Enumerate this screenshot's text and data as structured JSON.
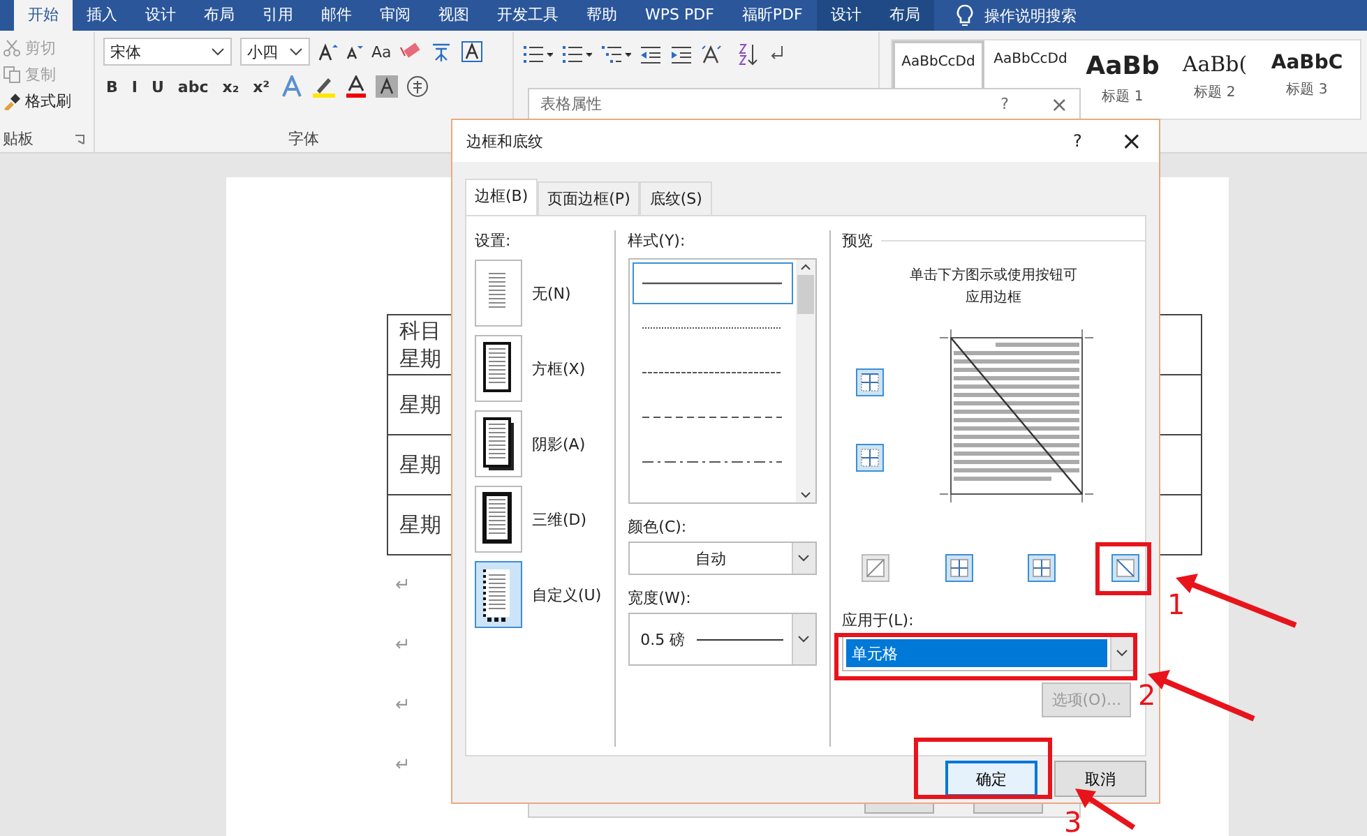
{
  "ribbon_tabs": [
    {
      "label": "开始",
      "selected": true,
      "contextual": false
    },
    {
      "label": "插入",
      "selected": false,
      "contextual": false
    },
    {
      "label": "设计",
      "selected": false,
      "contextual": false
    },
    {
      "label": "布局",
      "selected": false,
      "contextual": false
    },
    {
      "label": "引用",
      "selected": false,
      "contextual": false
    },
    {
      "label": "邮件",
      "selected": false,
      "contextual": false
    },
    {
      "label": "审阅",
      "selected": false,
      "contextual": false
    },
    {
      "label": "视图",
      "selected": false,
      "contextual": false
    },
    {
      "label": "开发工具",
      "selected": false,
      "contextual": false
    },
    {
      "label": "帮助",
      "selected": false,
      "contextual": false
    },
    {
      "label": "WPS PDF",
      "selected": false,
      "contextual": false
    },
    {
      "label": "福昕PDF",
      "selected": false,
      "contextual": false
    },
    {
      "label": "设计",
      "selected": false,
      "contextual": true
    },
    {
      "label": "布局",
      "selected": false,
      "contextual": true
    }
  ],
  "tell_me": "操作说明搜索",
  "clipboard": {
    "items": [
      {
        "label": "剪切",
        "kind": "cut",
        "disabled": true
      },
      {
        "label": "复制",
        "kind": "copy",
        "disabled": true
      },
      {
        "label": "格式刷",
        "kind": "brush",
        "disabled": false
      }
    ],
    "group_label": "贴板"
  },
  "font": {
    "font_name": "宋体",
    "font_size": "小四",
    "case_button": "Aa",
    "format_buttons": [
      "B",
      "I",
      "U",
      "abc",
      "x₂",
      "x²"
    ],
    "group_label": "字体"
  },
  "styles": [
    {
      "preview": "AaBbCcDd",
      "kind": "normal",
      "selected": true
    },
    {
      "preview": "AaBbCcDd",
      "kind": "normal",
      "selected": false
    },
    {
      "preview": "AaBb",
      "kind": "heading1",
      "name": "标题 1",
      "selected": false
    },
    {
      "preview": "AaBb(",
      "kind": "heading2",
      "name": "标题 2",
      "selected": false
    },
    {
      "preview": "AaBbC",
      "kind": "heading3",
      "name": "标题 3",
      "selected": false
    }
  ],
  "document": {
    "table_rows": [
      [
        "科目",
        "星期"
      ],
      [
        "星期"
      ],
      [
        "星期"
      ],
      [
        "星期"
      ]
    ],
    "paragraph_marks": [
      "↵",
      "↵",
      "↵",
      "↵"
    ]
  },
  "back_dialog": {
    "title": "表格属性",
    "help": "?",
    "close": "×"
  },
  "dialog": {
    "title": "边框和底纹",
    "help": "?",
    "close": "×",
    "tabs": [
      {
        "label": "边框(B)",
        "selected": true
      },
      {
        "label": "页面边框(P)",
        "selected": false
      },
      {
        "label": "底纹(S)",
        "selected": false
      }
    ],
    "settings_label": "设置:",
    "settings": [
      {
        "label": "无(N)",
        "kind": "none",
        "selected": false
      },
      {
        "label": "方框(X)",
        "kind": "box",
        "selected": false
      },
      {
        "label": "阴影(A)",
        "kind": "shadow",
        "selected": false
      },
      {
        "label": "三维(D)",
        "kind": "threed",
        "selected": false
      },
      {
        "label": "自定义(U)",
        "kind": "custom",
        "selected": true
      }
    ],
    "style_label": "样式(Y):",
    "line_styles": [
      {
        "kind": "solid",
        "selected": true
      },
      {
        "kind": "dotted",
        "selected": false
      },
      {
        "kind": "fine-dash",
        "selected": false
      },
      {
        "kind": "dash",
        "selected": false
      },
      {
        "kind": "dash-dot",
        "selected": false
      }
    ],
    "color_label": "颜色(C):",
    "color_value": "自动",
    "width_label": "宽度(W):",
    "width_value": "0.5 磅",
    "preview_label": "预览",
    "preview_hint": [
      "单击下方图示或使用按钮可",
      "应用边框"
    ],
    "side_buttons": [
      {
        "kind": "top",
        "on": true
      },
      {
        "kind": "inside-h",
        "on": true
      }
    ],
    "bottom_buttons": [
      {
        "kind": "diag-up",
        "on": false
      },
      {
        "kind": "inside-v",
        "on": true
      },
      {
        "kind": "inside-v",
        "on": true
      },
      {
        "kind": "diag-down",
        "on": true
      }
    ],
    "apply_label": "应用于(L):",
    "apply_value": "单元格",
    "options_button": {
      "label": "选项(O)...",
      "disabled": true
    },
    "buttons": [
      {
        "label": "确定",
        "default": true
      },
      {
        "label": "取消",
        "default": false
      }
    ]
  },
  "annotations": [
    "1",
    "2",
    "3"
  ]
}
